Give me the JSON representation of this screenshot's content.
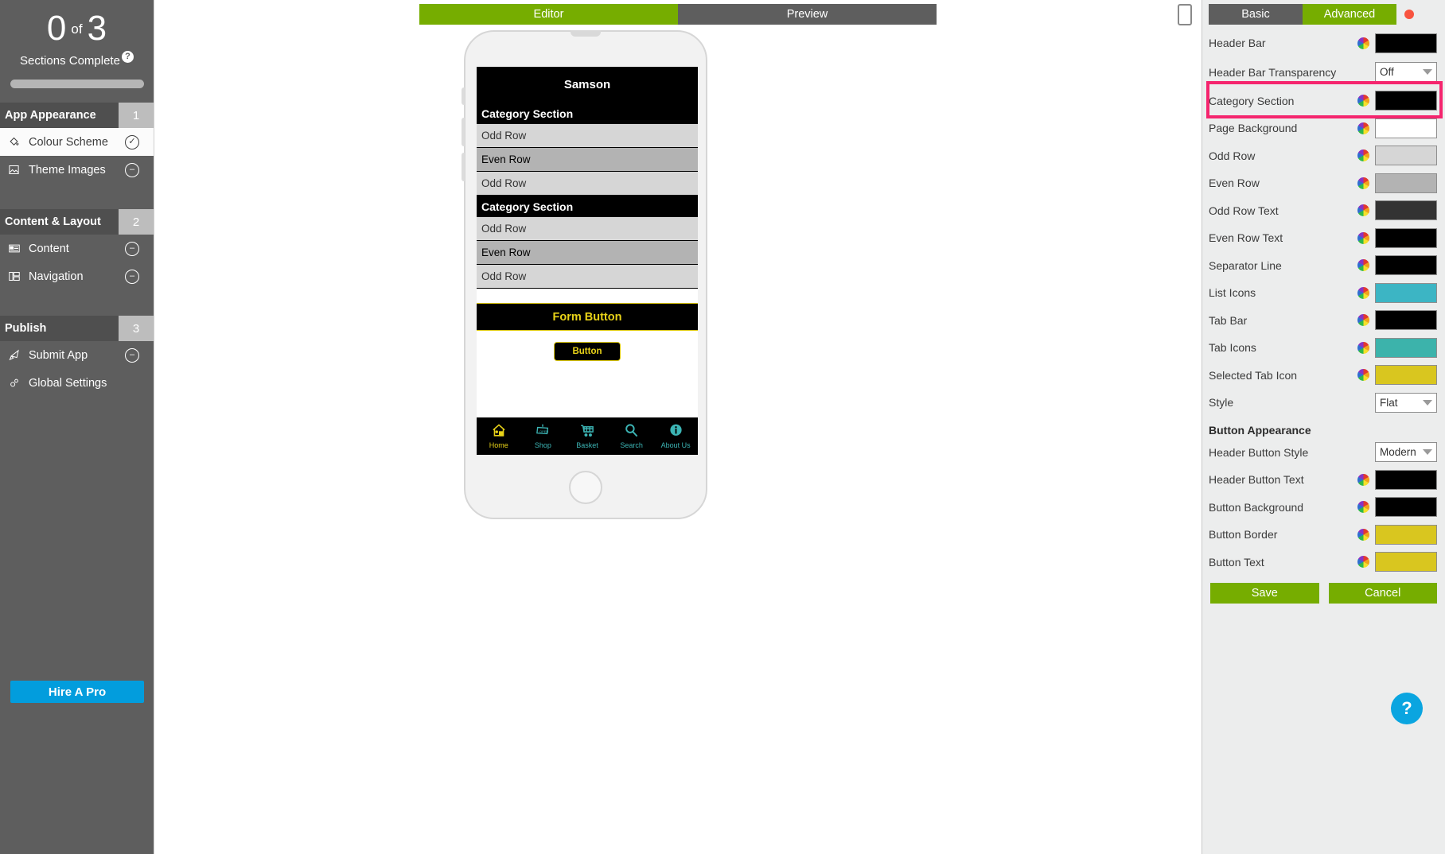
{
  "sidebar": {
    "progress": {
      "completed": "0",
      "of": "of",
      "total": "3",
      "label": "Sections Complete",
      "help": "?"
    },
    "sections": [
      {
        "title": "App Appearance",
        "number": "1",
        "items": [
          {
            "label": "Colour Scheme",
            "icon": "paint-bucket-icon",
            "state": "✓",
            "active": true
          },
          {
            "label": "Theme Images",
            "icon": "image-icon",
            "state": "–",
            "active": false
          }
        ]
      },
      {
        "title": "Content & Layout",
        "number": "2",
        "items": [
          {
            "label": "Content",
            "icon": "list-icon",
            "state": "–",
            "active": false
          },
          {
            "label": "Navigation",
            "icon": "layout-icon",
            "state": "–",
            "active": false
          }
        ]
      },
      {
        "title": "Publish",
        "number": "3",
        "items": [
          {
            "label": "Submit App",
            "icon": "rocket-icon",
            "state": "–",
            "active": false
          },
          {
            "label": "Global Settings",
            "icon": "gears-icon",
            "state": "",
            "active": false
          }
        ]
      }
    ],
    "hire_button": "Hire A Pro"
  },
  "topbar": {
    "editor_tab": "Editor",
    "preview_tab": "Preview"
  },
  "phone": {
    "header_title": "Samson",
    "rows": [
      {
        "type": "category",
        "label": "Category Section"
      },
      {
        "type": "odd",
        "label": "Odd Row"
      },
      {
        "type": "even",
        "label": "Even Row"
      },
      {
        "type": "odd",
        "label": "Odd Row"
      },
      {
        "type": "category",
        "label": "Category Section"
      },
      {
        "type": "odd",
        "label": "Odd Row"
      },
      {
        "type": "even",
        "label": "Even Row"
      },
      {
        "type": "odd",
        "label": "Odd Row"
      }
    ],
    "form_button": "Form Button",
    "inline_button": "Button",
    "tabs": [
      {
        "label": "Home",
        "icon": "home-icon",
        "selected": true
      },
      {
        "label": "Shop",
        "icon": "open-sign-icon",
        "selected": false
      },
      {
        "label": "Basket",
        "icon": "cart-icon",
        "selected": false
      },
      {
        "label": "Search",
        "icon": "magnifier-icon",
        "selected": false
      },
      {
        "label": "About Us",
        "icon": "info-icon",
        "selected": false
      }
    ]
  },
  "right_panel": {
    "tabs": {
      "basic": "Basic",
      "advanced": "Advanced"
    },
    "rows": [
      {
        "label": "Header Bar",
        "control": "swatch",
        "value": "#000000"
      },
      {
        "label": "Header Bar Transparency",
        "control": "select",
        "value": "Off",
        "highlighted": true
      },
      {
        "label": "Category Section",
        "control": "swatch",
        "value": "#000000"
      },
      {
        "label": "Page Background",
        "control": "swatch",
        "value": "#ffffff"
      },
      {
        "label": "Odd Row",
        "control": "swatch",
        "value": "#d6d6d6"
      },
      {
        "label": "Even Row",
        "control": "swatch",
        "value": "#b3b3b3"
      },
      {
        "label": "Odd Row Text",
        "control": "swatch",
        "value": "#333333"
      },
      {
        "label": "Even Row Text",
        "control": "swatch",
        "value": "#000000"
      },
      {
        "label": "Separator Line",
        "control": "swatch",
        "value": "#000000"
      },
      {
        "label": "List Icons",
        "control": "swatch",
        "value": "#3cb5c4"
      },
      {
        "label": "Tab Bar",
        "control": "swatch",
        "value": "#000000"
      },
      {
        "label": "Tab Icons",
        "control": "swatch",
        "value": "#3cb3ab"
      },
      {
        "label": "Selected Tab Icon",
        "control": "swatch",
        "value": "#d9c61f"
      },
      {
        "label": "Style",
        "control": "select",
        "value": "Flat"
      }
    ],
    "group_title": "Button Appearance",
    "rows2": [
      {
        "label": "Header Button Style",
        "control": "select",
        "value": "Modern"
      },
      {
        "label": "Header Button Text",
        "control": "swatch",
        "value": "#000000"
      },
      {
        "label": "Button Background",
        "control": "swatch",
        "value": "#000000"
      },
      {
        "label": "Button Border",
        "control": "swatch",
        "value": "#d9c61f"
      },
      {
        "label": "Button Text",
        "control": "swatch",
        "value": "#d9c61f"
      }
    ],
    "save_label": "Save",
    "cancel_label": "Cancel",
    "help_fab": "?"
  }
}
